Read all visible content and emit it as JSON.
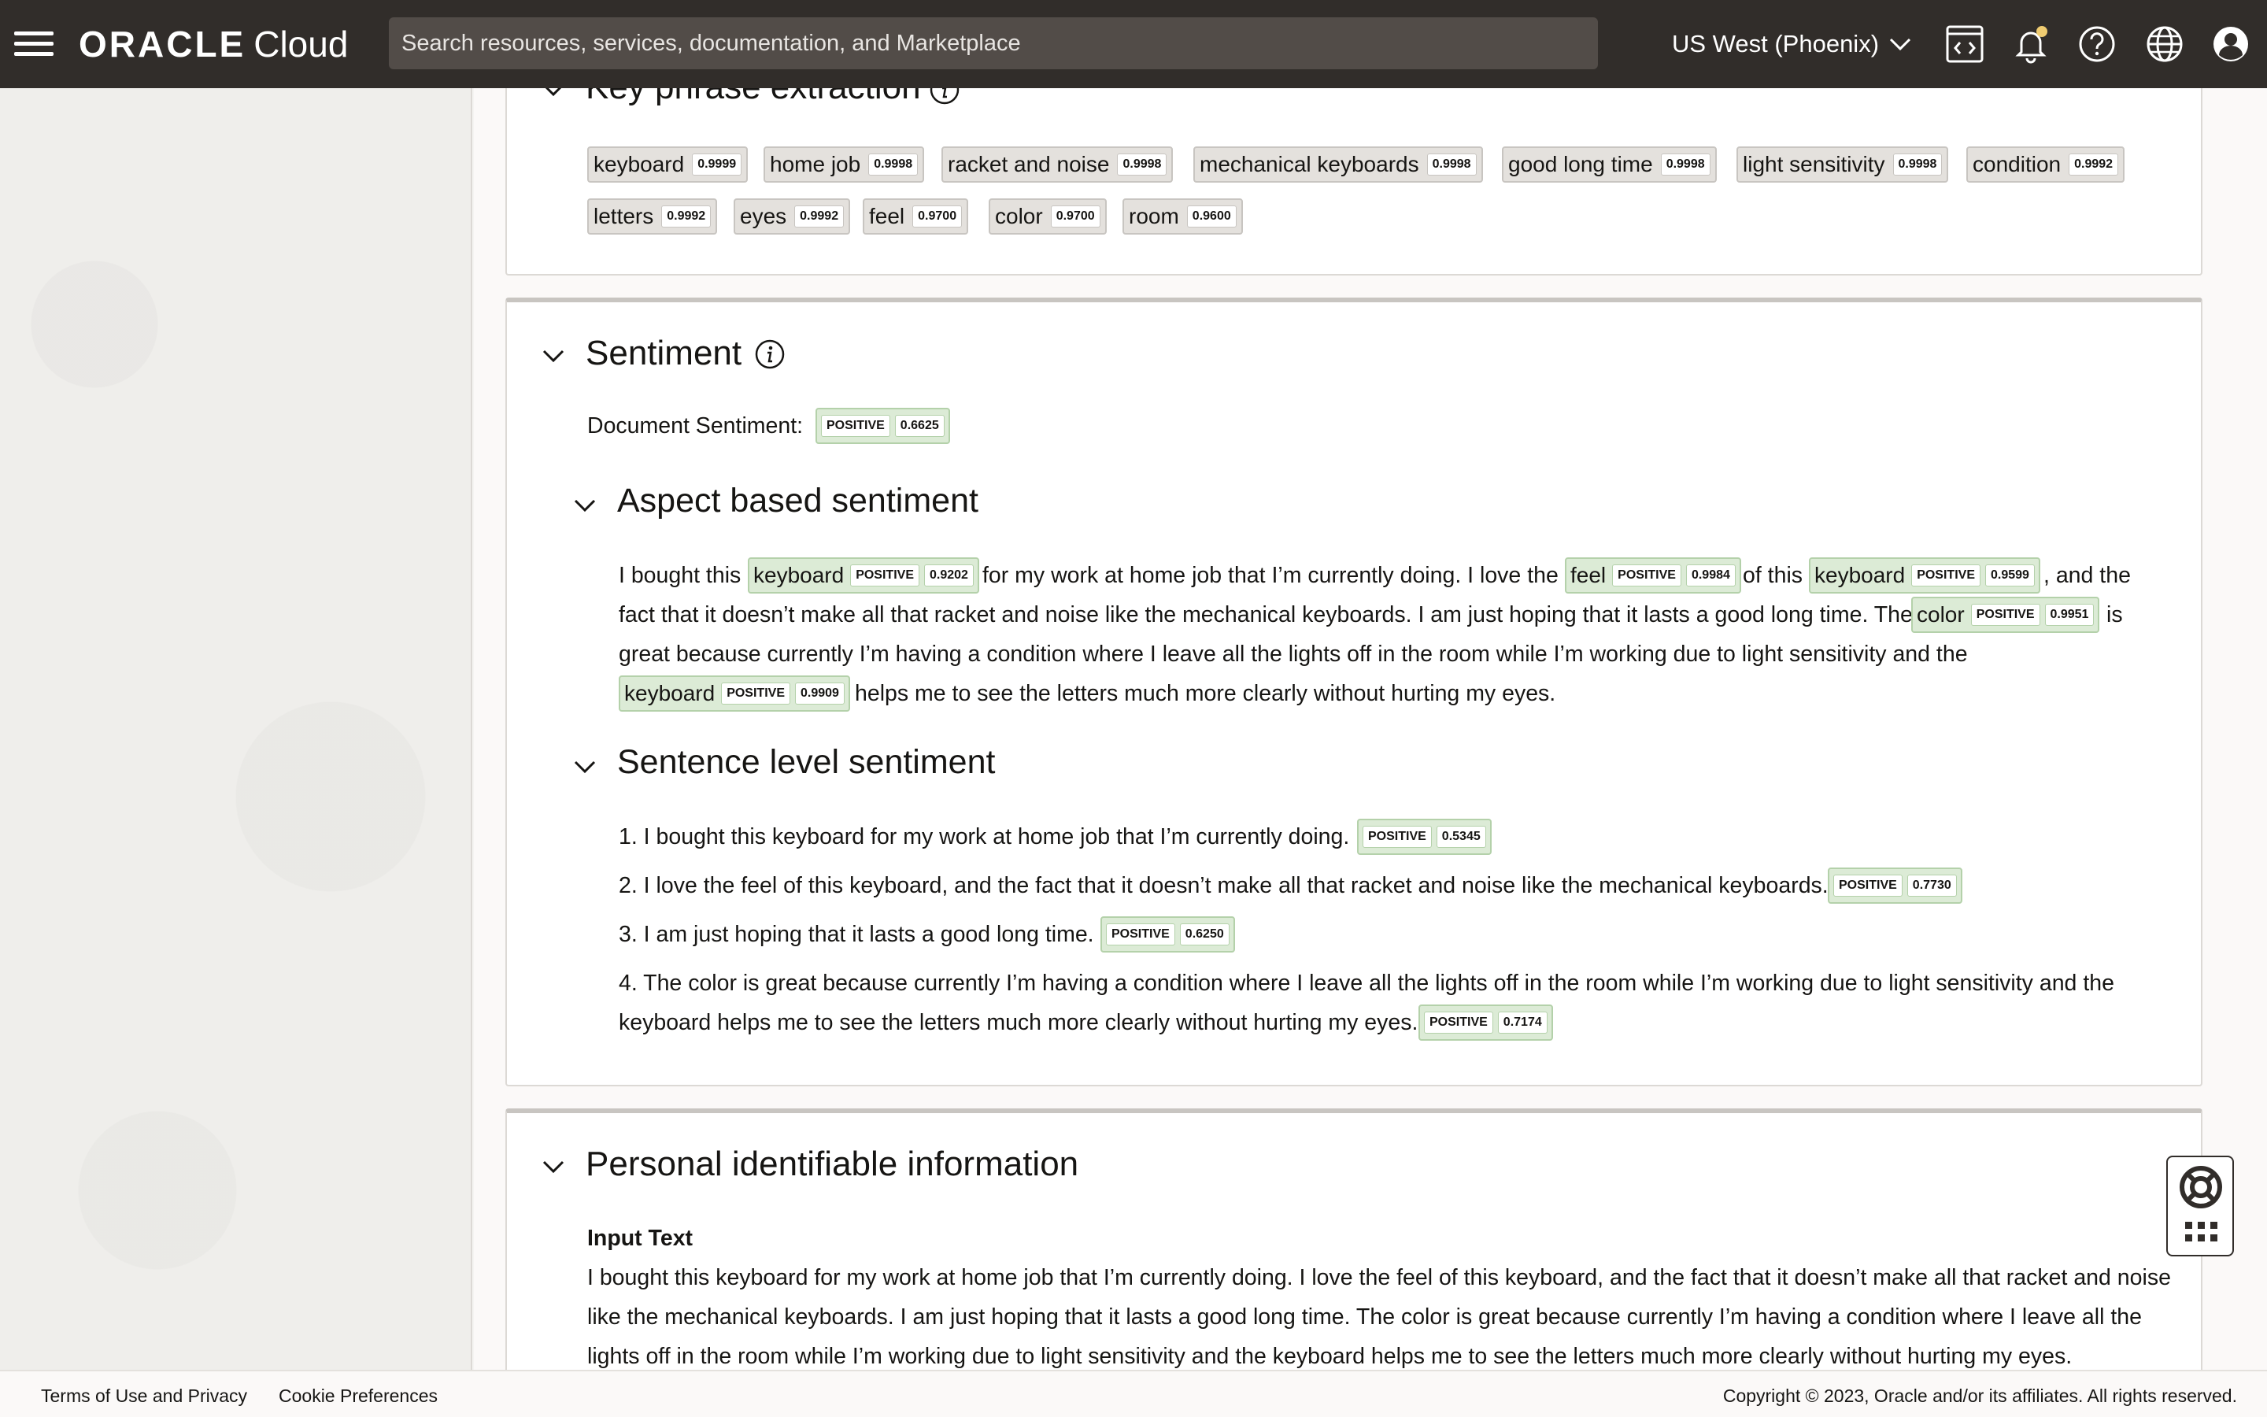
{
  "header": {
    "brand_primary": "ORACLE",
    "brand_secondary": "Cloud",
    "search_placeholder": "Search resources, services, documentation, and Marketplace",
    "region": "US West (Phoenix)"
  },
  "key_phrases": {
    "title": "Key phrase extraction",
    "phrases": [
      {
        "text": "keyboard",
        "score": "0.9999"
      },
      {
        "text": "home job",
        "score": "0.9998"
      },
      {
        "text": "racket and noise",
        "score": "0.9998"
      },
      {
        "text": "mechanical keyboards",
        "score": "0.9998"
      },
      {
        "text": "good long time",
        "score": "0.9998"
      },
      {
        "text": "light sensitivity",
        "score": "0.9998"
      },
      {
        "text": "condition",
        "score": "0.9992"
      },
      {
        "text": "letters",
        "score": "0.9992"
      },
      {
        "text": "eyes",
        "score": "0.9992"
      },
      {
        "text": "feel",
        "score": "0.9700"
      },
      {
        "text": "color",
        "score": "0.9700"
      },
      {
        "text": "room",
        "score": "0.9600"
      }
    ]
  },
  "sentiment": {
    "title": "Sentiment",
    "doc_label": "Document Sentiment:",
    "doc_value": "POSITIVE",
    "doc_score": "0.6625",
    "aspect": {
      "title": "Aspect based sentiment",
      "segments": {
        "s1": "I bought this",
        "a1": {
          "text": "keyboard",
          "label": "POSITIVE",
          "score": "0.9202"
        },
        "s2": "for my work at home job that I’m currently doing. I love the",
        "a2": {
          "text": "feel",
          "label": "POSITIVE",
          "score": "0.9984"
        },
        "s3": "of this",
        "a3": {
          "text": "keyboard",
          "label": "POSITIVE",
          "score": "0.9599"
        },
        "s4": ", and the",
        "s5": "fact that it doesn’t make all that racket and noise like the mechanical keyboards. I am just hoping that it lasts a good long time. The",
        "a4": {
          "text": "color",
          "label": "POSITIVE",
          "score": "0.9951"
        },
        "s6": "is",
        "s7": "great because currently I’m having a condition where I leave all the lights off in the room while I’m working due to light sensitivity and the",
        "a5": {
          "text": "keyboard",
          "label": "POSITIVE",
          "score": "0.9909"
        },
        "s8": "helps me to see the letters much more clearly without hurting my eyes."
      }
    },
    "sentence": {
      "title": "Sentence level sentiment",
      "items": [
        {
          "text": "1. I bought this keyboard for my work at home job that I’m currently doing.",
          "label": "POSITIVE",
          "score": "0.5345"
        },
        {
          "text": "2. I love the feel of this keyboard, and the fact that it doesn’t make all that racket and noise like the mechanical keyboards.",
          "label": "POSITIVE",
          "score": "0.7730"
        },
        {
          "text": "3. I am just hoping that it lasts a good long time.",
          "label": "POSITIVE",
          "score": "0.6250"
        },
        {
          "text": "4. The color is great because currently I’m having a condition where I leave all the lights off in the room while I’m working due to light sensitivity and the",
          "text2": "keyboard helps me to see the letters much more clearly without hurting my eyes.",
          "label": "POSITIVE",
          "score": "0.7174"
        }
      ]
    }
  },
  "pii": {
    "title": "Personal identifiable information",
    "input_label": "Input Text",
    "lines": [
      "I bought this keyboard for my work at home job that I’m currently doing. I love the feel of this keyboard, and the fact that it doesn’t make all that racket and noise",
      "like the mechanical keyboards. I am just hoping that it lasts a good long time. The color is great because currently I’m having a condition where I leave all the",
      "lights off in the room while I’m working due to light sensitivity and the keyboard helps me to see the letters much more clearly without hurting my eyes."
    ]
  },
  "footer": {
    "terms": "Terms of Use and Privacy",
    "cookies": "Cookie Preferences",
    "copyright": "Copyright © 2023, Oracle and/or its affiliates. All rights reserved."
  }
}
